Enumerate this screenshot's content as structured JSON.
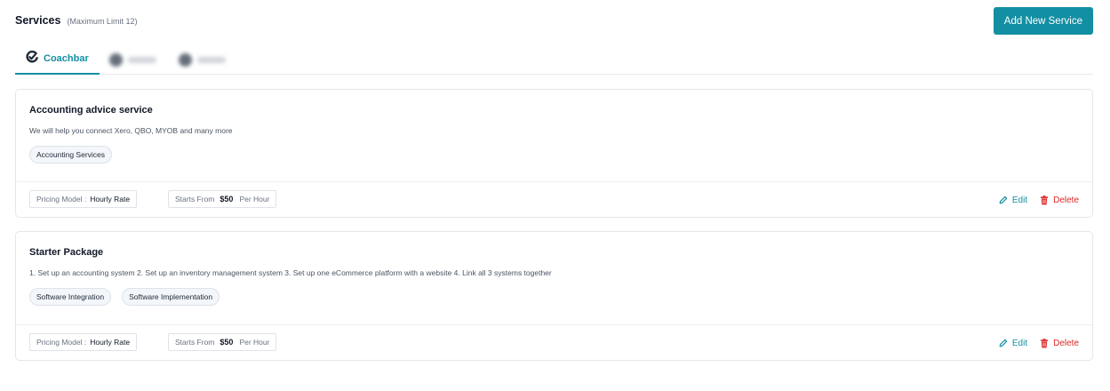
{
  "header": {
    "title": "Services",
    "limit_note": "(Maximum Limit 12)",
    "add_button": "Add New Service"
  },
  "tabs": [
    {
      "label": "Coachbar",
      "icon": "coachbar-logo-icon",
      "active": true
    },
    {
      "label": "",
      "icon": "blurred-logo-icon",
      "active": false
    },
    {
      "label": "",
      "icon": "blurred-logo-icon",
      "active": false
    }
  ],
  "services": [
    {
      "title": "Accounting advice service",
      "description": "We will help you connect Xero, QBO, MYOB and many more",
      "tags": [
        "Accounting Services"
      ],
      "pricing_label": "Pricing Model :",
      "pricing_value": "Hourly Rate",
      "starts_label": "Starts From",
      "price": "$50",
      "unit": "Per Hour",
      "edit_label": "Edit",
      "delete_label": "Delete"
    },
    {
      "title": "Starter Package",
      "description": "1. Set up an accounting system 2. Set up an inventory management system 3. Set up one eCommerce platform with a website 4. Link all 3 systems together",
      "tags": [
        "Software Integration",
        "Software Implementation"
      ],
      "pricing_label": "Pricing Model :",
      "pricing_value": "Hourly Rate",
      "starts_label": "Starts From",
      "price": "$50",
      "unit": "Per Hour",
      "edit_label": "Edit",
      "delete_label": "Delete"
    }
  ],
  "colors": {
    "accent": "#138fa3",
    "danger": "#dc2626",
    "border": "#e4e7eb"
  }
}
